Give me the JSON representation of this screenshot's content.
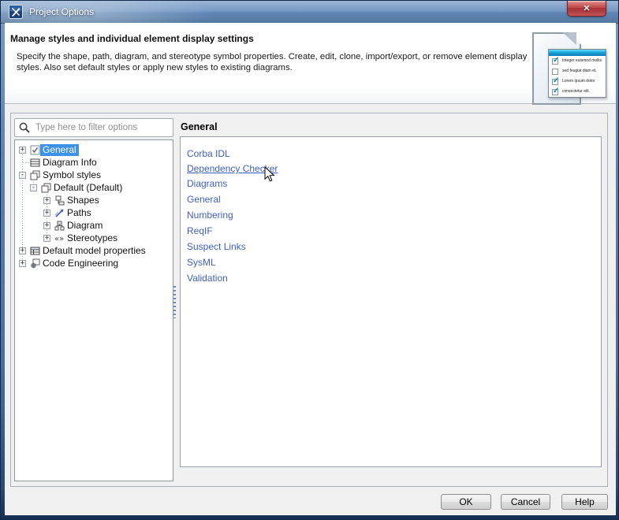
{
  "window": {
    "title": "Project Options"
  },
  "header": {
    "title": "Manage styles and individual element display settings",
    "description": "Specify the shape, path, diagram, and stereotype symbol properties. Create, edit, clone, import/export, or remove element display styles. Also set default styles or apply new styles to existing diagrams.",
    "checklist": {
      "items": [
        {
          "checked": true,
          "text": "Integer euismod mollis"
        },
        {
          "checked": false,
          "text": "sed feugiat diam et."
        },
        {
          "checked": true,
          "text": "Lorem ipsum dolor"
        },
        {
          "checked": true,
          "text": "consectetur elit."
        }
      ]
    }
  },
  "filter": {
    "placeholder": "Type here to filter options"
  },
  "tree": {
    "items": [
      {
        "label": "General",
        "expander": "+",
        "selected": true,
        "icon": "checkbox-icon"
      },
      {
        "label": "Diagram Info",
        "expander": "",
        "selected": false,
        "icon": "diagram-info-icon"
      },
      {
        "label": "Symbol styles",
        "expander": "-",
        "selected": false,
        "icon": "symbol-styles-icon"
      },
      {
        "label": "Default (Default)",
        "expander": "-",
        "selected": false,
        "icon": "symbol-styles-icon"
      },
      {
        "label": "Shapes",
        "expander": "+",
        "selected": false,
        "icon": "shapes-icon"
      },
      {
        "label": "Paths",
        "expander": "+",
        "selected": false,
        "icon": "paths-icon"
      },
      {
        "label": "Diagram",
        "expander": "+",
        "selected": false,
        "icon": "diagram-icon"
      },
      {
        "label": "Stereotypes",
        "expander": "+",
        "selected": false,
        "icon": "stereotypes-icon"
      },
      {
        "label": "Default model properties",
        "expander": "+",
        "selected": false,
        "icon": "properties-table-icon"
      },
      {
        "label": "Code Engineering",
        "expander": "+",
        "selected": false,
        "icon": "code-engineering-icon"
      }
    ]
  },
  "content": {
    "heading": "General",
    "links": [
      {
        "label": "Corba IDL",
        "hovered": false
      },
      {
        "label": "Dependency Checker",
        "hovered": true
      },
      {
        "label": "Diagrams",
        "hovered": false
      },
      {
        "label": "General",
        "hovered": false
      },
      {
        "label": "Numbering",
        "hovered": false
      },
      {
        "label": "ReqIF",
        "hovered": false
      },
      {
        "label": "Suspect Links",
        "hovered": false
      },
      {
        "label": "SysML",
        "hovered": false
      },
      {
        "label": "Validation",
        "hovered": false
      }
    ]
  },
  "footer": {
    "ok_label": "OK",
    "cancel_label": "Cancel",
    "help_label": "Help"
  },
  "colors": {
    "link": "#3e5fc1",
    "tree_selection": "#3c92e8",
    "titlebar_blue": "#5c84b2",
    "close_red": "#b04046"
  }
}
